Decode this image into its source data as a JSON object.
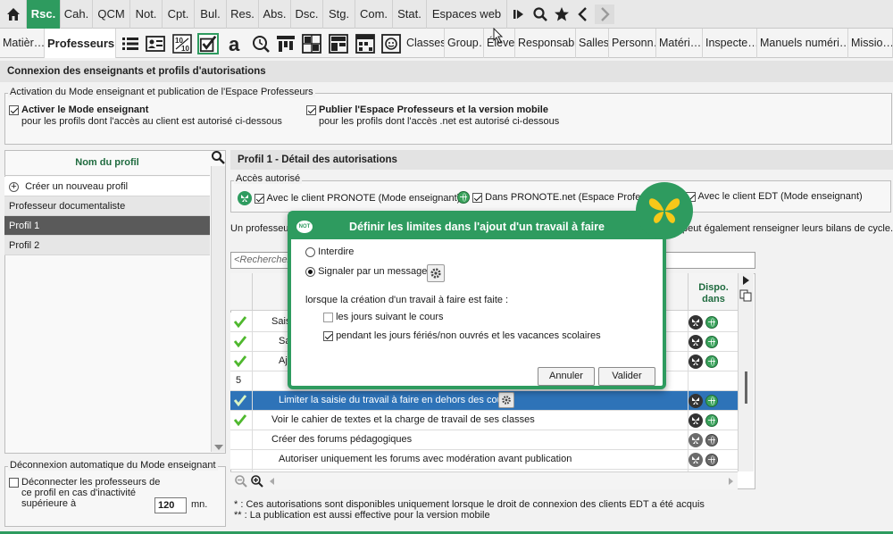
{
  "top_menu": {
    "items": [
      "Rsc.",
      "Cah.",
      "QCM",
      "Not.",
      "Cpt.",
      "Bul.",
      "Res.",
      "Abs.",
      "Dsc.",
      "Stg.",
      "Com.",
      "Stat.",
      "Espaces web"
    ],
    "active": "Rsc.",
    "icons": [
      "home-icon",
      "skip-icon",
      "search-icon",
      "star-icon",
      "back-arrow-icon",
      "forward-arrow-icon"
    ],
    "accent": "#2e9b5f"
  },
  "sub_menu": {
    "items_left": [
      "Matièr…",
      "Professeurs"
    ],
    "active": "Professeurs",
    "icons": [
      "list-icon",
      "id-card-icon",
      "grade-icon",
      "check-square-icon",
      "letter-a-icon",
      "clock-search-icon",
      "hierarchy-icon",
      "grid-icon",
      "window-grid-icon",
      "calendar-grid-icon",
      "face-icon"
    ],
    "items_right": [
      "Classes",
      "Group…",
      "Élèves",
      "Responsab…",
      "Salles",
      "Personn…",
      "Matéri…",
      "Inspecte…",
      "Manuels numéri…",
      "Missio…"
    ]
  },
  "header": {
    "title": "Connexion des enseignants et profils d'autorisations"
  },
  "activation": {
    "legend": "Activation du Mode enseignant et publication de l'Espace Professeurs",
    "option1_title": "Activer le Mode enseignant",
    "option1_desc": "pour les profils dont l'accès au client est autorisé ci-dessous",
    "option2_title": "Publier l'Espace Professeurs et la version mobile",
    "option2_desc": "pour les profils dont l'accès .net est autorisé ci-dessous"
  },
  "profiles": {
    "column_header": "Nom du profil",
    "create": "Créer un nouveau profil",
    "items": [
      "Professeur documentaliste",
      "Profil 1",
      "Profil 2"
    ],
    "selected": "Profil 1"
  },
  "disconnect": {
    "legend": "Déconnexion automatique du Mode enseignant",
    "line1": "Déconnecter les professeurs de",
    "line2": "ce profil en cas d'inactivité",
    "line3": "supérieure à",
    "value": "120",
    "unit": "mn."
  },
  "detail": {
    "title": "Profil 1 - Détail des autorisations",
    "access_legend": "Accès autorisé",
    "access1": "Avec le client PRONOTE (Mode enseignant)",
    "access2": "Dans PRONOTE.net (Espace Professe",
    "access3": "Avec le client EDT (Mode enseignant)",
    "info_left": "Un professeur",
    "info_right": "peut également renseigner leurs bilans de cycle.",
    "search_placeholder": "<Recherchez",
    "dispo_header": "Dispo. dans",
    "rows": [
      {
        "check": true,
        "num": "",
        "text": "Saisi"
      },
      {
        "check": true,
        "num": "",
        "text": "Sa"
      },
      {
        "check": true,
        "num": "",
        "text": "Aj"
      },
      {
        "check": false,
        "num": "5",
        "text": ""
      },
      {
        "check": true,
        "num": "",
        "text": "Limiter la saisie du travail à faire en dehors des cours"
      },
      {
        "check": true,
        "num": "",
        "text": "Voir le cahier de textes et la charge de travail de ses classes"
      },
      {
        "check": false,
        "num": "",
        "text": "Créer des forums pédagogiques"
      },
      {
        "check": false,
        "num": "",
        "text": "Autoriser uniquement les forums avec modération avant publication"
      }
    ],
    "footnote1": "* : Ces autorisations sont disponibles uniquement lorsque le droit de connexion des clients EDT a été acquis",
    "footnote2": "** : La publication est aussi effective pour la version mobile"
  },
  "dialog": {
    "badge": "NOT",
    "title": "Définir les limites dans l'ajout d'un travail à faire",
    "option_forbid": "Interdire",
    "option_signal": "Signaler par un message",
    "condition": "lorsque la création d'un travail à faire est faite :",
    "check1": "les jours suivant le cours",
    "check2": "pendant les jours fériés/non ouvrés et les vacances scolaires",
    "cancel": "Annuler",
    "validate": "Valider"
  }
}
